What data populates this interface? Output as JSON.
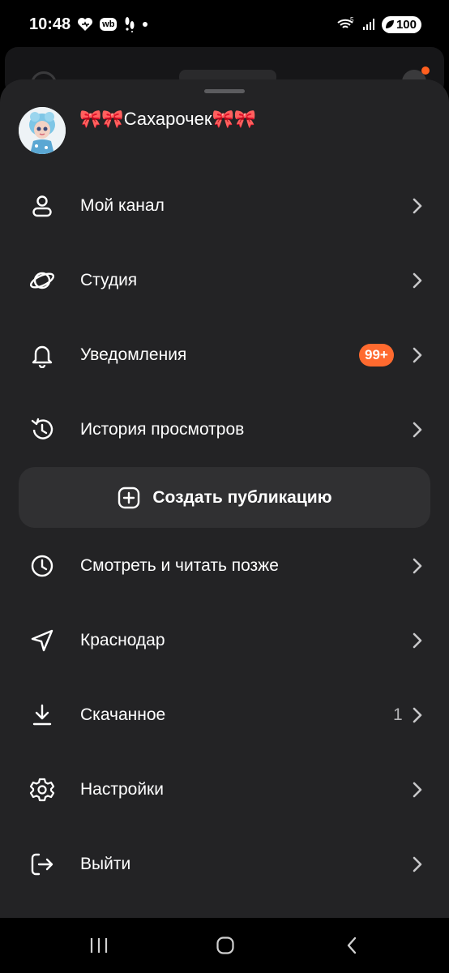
{
  "status_bar": {
    "time": "10:48",
    "wb_badge": "wb",
    "network": "5",
    "battery": "100"
  },
  "profile": {
    "name": "🎀🎀Сахарочек🎀🎀",
    "avatar_icon": "doll-avatar"
  },
  "menu": {
    "items": [
      {
        "label": "Мой канал",
        "icon": "user-icon"
      },
      {
        "label": "Студия",
        "icon": "orbit-icon"
      },
      {
        "label": "Уведомления",
        "icon": "bell-icon",
        "badge": "99+"
      },
      {
        "label": "История просмотров",
        "icon": "history-icon"
      },
      {
        "label": "Смотреть и читать позже",
        "icon": "clock-icon"
      },
      {
        "label": "Краснодар",
        "icon": "location-arrow-icon"
      },
      {
        "label": "Скачанное",
        "icon": "download-icon",
        "count": "1"
      },
      {
        "label": "Настройки",
        "icon": "gear-icon"
      },
      {
        "label": "Выйти",
        "icon": "logout-icon"
      }
    ],
    "create_button": "Создать публикацию"
  },
  "colors": {
    "sheet": "#232325",
    "badge": "#ff6a2f",
    "button": "#303032"
  }
}
